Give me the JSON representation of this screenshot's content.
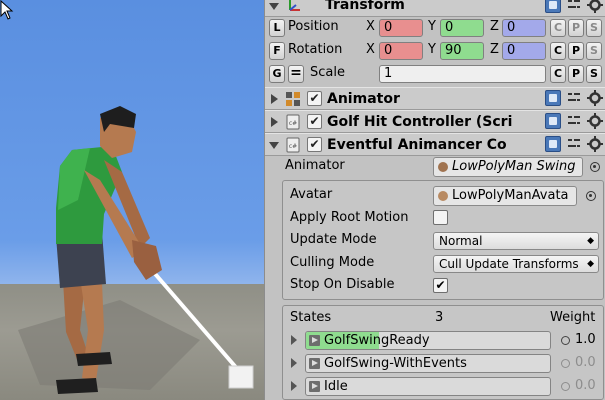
{
  "transform": {
    "title": "Transform",
    "rows": [
      {
        "btn": "L",
        "label": "Position",
        "x": "0",
        "y": "0",
        "z": "0"
      },
      {
        "btn": "F",
        "label": "Rotation",
        "x": "0",
        "y": "90",
        "z": "0"
      }
    ],
    "scale": {
      "btn": "G",
      "label": "Scale",
      "value": "1"
    },
    "axis_x": "X",
    "axis_y": "Y",
    "axis_z": "Z",
    "btn_c": "C",
    "btn_p": "P",
    "btn_s": "S"
  },
  "animator": {
    "title": "Animator",
    "enabled": true
  },
  "golf_hit": {
    "title": "Golf Hit Controller (Scri",
    "enabled": true
  },
  "eventful": {
    "title": "Eventful Animancer Co",
    "enabled": true,
    "animator_label": "Animator",
    "animator_value": "LowPolyMan Swing",
    "avatar_label": "Avatar",
    "avatar_value": "LowPolyManAvata",
    "apply_root_motion_label": "Apply Root Motion",
    "apply_root_motion": false,
    "update_mode_label": "Update Mode",
    "update_mode_value": "Normal",
    "culling_mode_label": "Culling Mode",
    "culling_mode_value": "Cull Update Transforms",
    "stop_on_disable_label": "Stop On Disable",
    "stop_on_disable": true
  },
  "states": {
    "header": "States",
    "count": "3",
    "weight_label": "Weight",
    "items": [
      {
        "name": "GolfSwingReady",
        "weight": "1.0",
        "active": true,
        "progress": 0.3
      },
      {
        "name": "GolfSwing-WithEvents",
        "weight": "0.0",
        "active": false,
        "progress": 0
      },
      {
        "name": "Idle",
        "weight": "0.0",
        "active": false,
        "progress": 0
      }
    ]
  },
  "colors": {
    "x_field": "#e88f8f",
    "y_field": "#8fdc8f",
    "z_field": "#a3a9ea",
    "sky": "#5a8fe0",
    "shirt": "#2e9a3e"
  },
  "icons": [
    "transform-icon",
    "animator-icon",
    "script-icon",
    "help-book-icon",
    "preset-icon",
    "gear-icon",
    "object-picker-icon",
    "check-icon",
    "dropdown-arrow-icon",
    "mouse-cursor-icon"
  ]
}
